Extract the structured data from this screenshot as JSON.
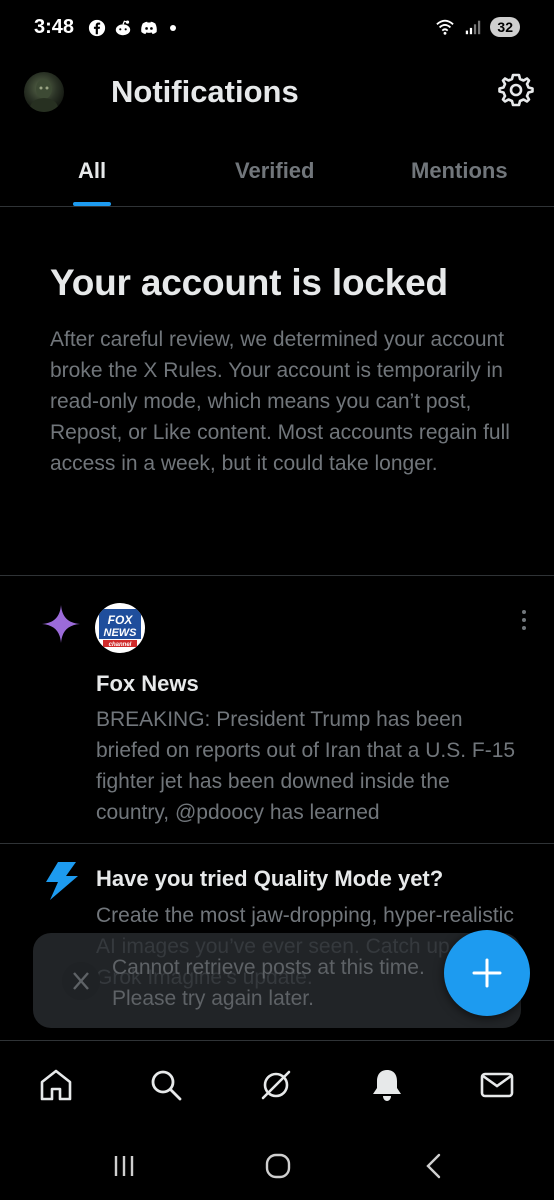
{
  "status_bar": {
    "time": "3:48",
    "left_icons": [
      "facebook-icon",
      "reddit-icon",
      "discord-icon"
    ],
    "battery": "32"
  },
  "header": {
    "title": "Notifications"
  },
  "tabs": [
    {
      "label": "All",
      "active": true
    },
    {
      "label": "Verified",
      "active": false
    },
    {
      "label": "Mentions",
      "active": false
    }
  ],
  "locked_notice": {
    "title": "Your account is locked",
    "body": "After careful review, we determined your account broke the X Rules. Your account is temporarily in read-only mode, which means you can’t post, Repost, or Like content. Most accounts regain full access in a week, but it could take longer."
  },
  "notifications": [
    {
      "icon": "sparkle-icon",
      "avatar_text": "FOX NEWS channel",
      "name": "Fox News",
      "text": "BREAKING: President Trump has been briefed on reports out of Iran that a U.S. F-15 fighter jet has been downed inside the country, @pdoocy has learned"
    },
    {
      "icon": "lightning-icon",
      "name": "Have you tried Quality Mode yet?",
      "text": "Create the most jaw-dropping, hyper-realistic AI images you’ve ever seen. Catch up on Grok Imagine’s update."
    }
  ],
  "toast": {
    "text": "Cannot retrieve posts at this time. Please try again later."
  },
  "bottom_nav": [
    "home-icon",
    "search-icon",
    "grok-icon",
    "notifications-icon",
    "messages-icon"
  ],
  "colors": {
    "accent": "#1d9bf0",
    "sparkle": "#9b6bd9",
    "secondary_text": "#71767b"
  }
}
